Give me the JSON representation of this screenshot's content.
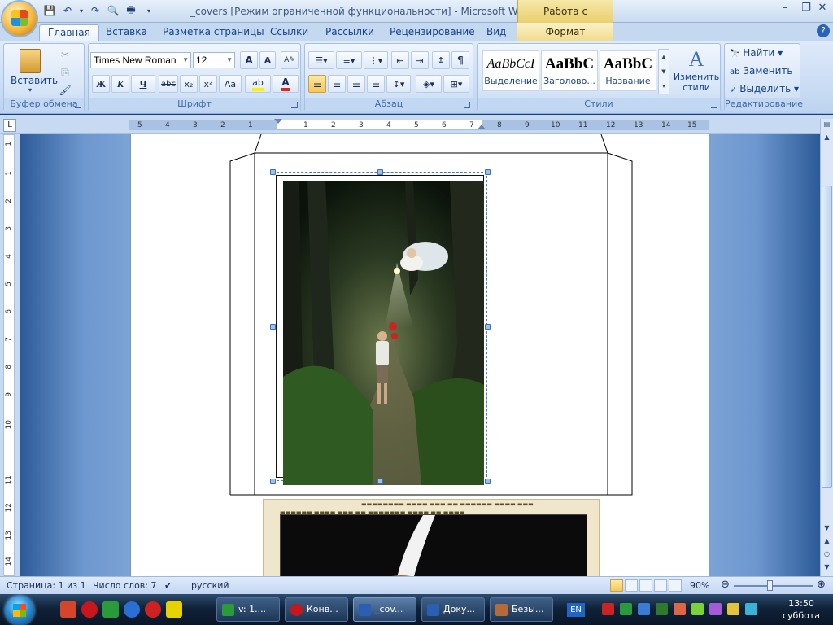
{
  "window": {
    "title": "_covers [Режим ограниченной функциональности] - Microsoft Word",
    "contextual_tab_group": "Работа с надписями"
  },
  "ribbon_tabs": [
    "Главная",
    "Вставка",
    "Разметка страницы",
    "Ссылки",
    "Рассылки",
    "Рецензирование",
    "Вид",
    "Формат"
  ],
  "clipboard": {
    "paste_label": "Вставить",
    "group_label": "Буфер обмена"
  },
  "font": {
    "font_name": "Times New Roman",
    "font_size": "12",
    "group_label": "Шрифт",
    "bold": "Ж",
    "italic": "К",
    "underline": "Ч",
    "strike": "abc",
    "subscript": "x₂",
    "superscript": "x²",
    "change_case": "Aa",
    "grow": "A",
    "shrink": "A"
  },
  "paragraph": {
    "group_label": "Абзац",
    "pilcrow": "¶"
  },
  "styles": {
    "group_label": "Стили",
    "items": [
      {
        "preview": "AaBbCcI",
        "name": "Выделение"
      },
      {
        "preview": "AaBbC",
        "name": "Заголово..."
      },
      {
        "preview": "AaBbC",
        "name": "Название"
      }
    ],
    "change_styles_label": "Изменить стили"
  },
  "editing": {
    "group_label": "Редактирование",
    "find": "Найти",
    "replace": "Заменить",
    "select": "Выделить"
  },
  "ruler": {
    "ticks": [
      "5",
      "4",
      "3",
      "2",
      "1",
      "1",
      "2",
      "3",
      "4",
      "5",
      "6",
      "7",
      "8",
      "9",
      "10",
      "11",
      "12",
      "13",
      "14",
      "15"
    ],
    "vticks": [
      "1",
      "1",
      "2",
      "3",
      "4",
      "5",
      "6",
      "7",
      "8",
      "9",
      "10",
      "11",
      "12",
      "13",
      "14"
    ]
  },
  "statusbar": {
    "page": "Страница: 1 из 1",
    "words": "Число слов: 7",
    "language": "русский",
    "zoom": "90%"
  },
  "taskbar": {
    "tasks": [
      {
        "label": "v: 1...."
      },
      {
        "label": "Конв..."
      },
      {
        "label": "_cov..."
      },
      {
        "label": "Доку..."
      },
      {
        "label": "Безы..."
      }
    ],
    "lang": "EN",
    "time": "13:50",
    "day": "суббота"
  },
  "colors": {
    "ribbon": "#c8dbf3",
    "accent": "#15428b",
    "contextual": "#f1dc8c"
  }
}
